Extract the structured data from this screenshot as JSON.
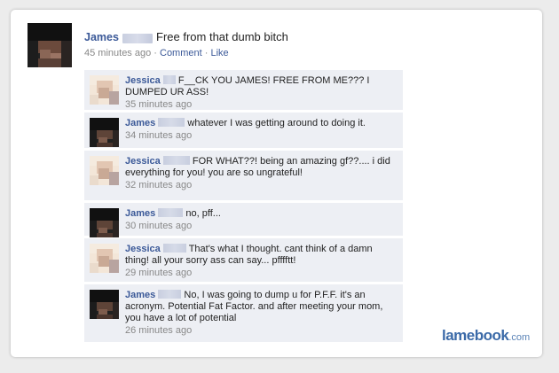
{
  "post": {
    "author": "James",
    "text": "Free from that dumb bitch",
    "time": "45 minutes ago",
    "sep1": " · ",
    "comment_link": "Comment",
    "sep2": " · ",
    "like_link": "Like"
  },
  "comments": [
    {
      "author": "Jessica",
      "text": "F__CK YOU JAMES! FREE FROM ME??? I DUMPED UR ASS!",
      "time": "35 minutes ago"
    },
    {
      "author": "James",
      "text": "whatever I was getting around to doing it.",
      "time": "34 minutes ago"
    },
    {
      "author": "Jessica",
      "text": "FOR WHAT??! being an amazing gf??.... i did everything for you! you are so ungrateful!",
      "time": "32 minutes ago"
    },
    {
      "author": "James",
      "text": "no, pff...",
      "time": "30 minutes ago"
    },
    {
      "author": "Jessica",
      "text": "That's what I thought. cant think of a damn thing! all your sorry ass can say... pfffftt!",
      "time": "29 minutes ago"
    },
    {
      "author": "James",
      "text": "No, I was going to dump u for P.F.F. it's an acronym. Potential Fat Factor. and after meeting your mom, you have a lot of potential",
      "time": "26 minutes ago"
    }
  ],
  "watermark": {
    "brand": "lamebook",
    "domain": ".com"
  },
  "colors": {
    "link": "#3b5998",
    "comment_bg": "#edeff4",
    "meta": "#888888"
  }
}
